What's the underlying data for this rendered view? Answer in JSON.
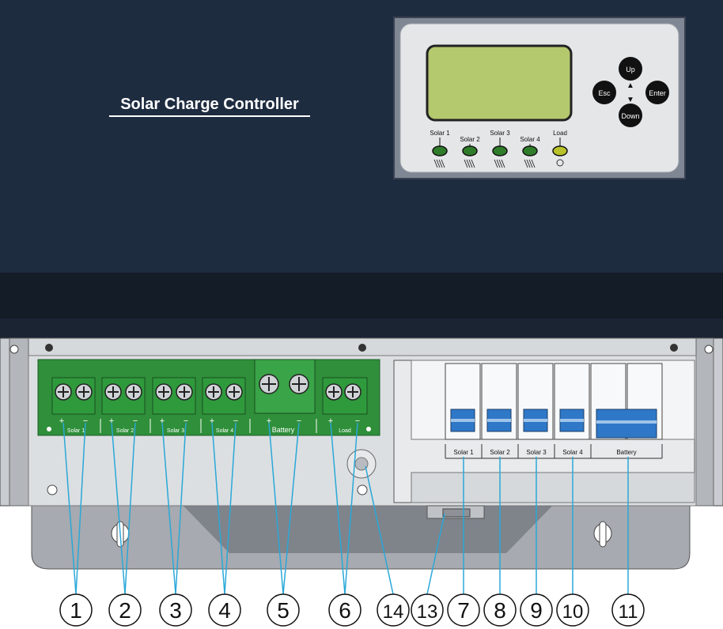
{
  "device": {
    "title": "Solar Charge Controller"
  },
  "display_panel": {
    "buttons": [
      {
        "id": "up",
        "label": "Up"
      },
      {
        "id": "esc",
        "label": "Esc"
      },
      {
        "id": "enter",
        "label": "Enter"
      },
      {
        "id": "down",
        "label": "Down"
      }
    ],
    "arrow_up": "▲",
    "arrow_down": "▼",
    "indicators": [
      {
        "label": "Solar 1",
        "color": "#2f7d2a"
      },
      {
        "label": "Solar 2",
        "color": "#2f7d2a"
      },
      {
        "label": "Solar 3",
        "color": "#2f7d2a"
      },
      {
        "label": "Solar 4",
        "color": "#2f7d2a"
      },
      {
        "label": "Load",
        "color": "#b8c22a"
      }
    ]
  },
  "terminals": {
    "plus": "+",
    "minus": "−",
    "groups": [
      "Solar 1",
      "Solar 2",
      "Solar 3",
      "Solar 4",
      "Battery",
      "Load"
    ]
  },
  "breakers": {
    "labels": [
      "Solar 1",
      "Solar 2",
      "Solar 3",
      "Solar 4",
      "Battery"
    ]
  },
  "callouts": [
    "1",
    "2",
    "3",
    "4",
    "5",
    "6",
    "14",
    "13",
    "7",
    "8",
    "9",
    "10",
    "11"
  ],
  "colors": {
    "housing": "#1e2c40",
    "lcd": "#b4c86e",
    "terminal_block": "#2f8f3a",
    "breaker_blue": "#2f78c8",
    "leader_line": "#2aa8d8"
  }
}
